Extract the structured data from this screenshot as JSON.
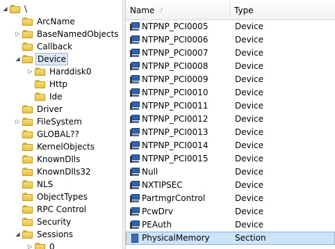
{
  "tree": {
    "items": [
      {
        "label": "\\",
        "level": 0,
        "expander": "open",
        "selected": false
      },
      {
        "label": "ArcName",
        "level": 1,
        "expander": "none",
        "selected": false
      },
      {
        "label": "BaseNamedObjects",
        "level": 1,
        "expander": "closed",
        "selected": false
      },
      {
        "label": "Callback",
        "level": 1,
        "expander": "none",
        "selected": false
      },
      {
        "label": "Device",
        "level": 1,
        "expander": "open",
        "selected": true
      },
      {
        "label": "Harddisk0",
        "level": 2,
        "expander": "closed",
        "selected": false
      },
      {
        "label": "Http",
        "level": 2,
        "expander": "none",
        "selected": false
      },
      {
        "label": "Ide",
        "level": 2,
        "expander": "none",
        "selected": false
      },
      {
        "label": "Driver",
        "level": 1,
        "expander": "none",
        "selected": false
      },
      {
        "label": "FileSystem",
        "level": 1,
        "expander": "closed",
        "selected": false
      },
      {
        "label": "GLOBAL??",
        "level": 1,
        "expander": "none",
        "selected": false
      },
      {
        "label": "KernelObjects",
        "level": 1,
        "expander": "none",
        "selected": false
      },
      {
        "label": "KnownDlls",
        "level": 1,
        "expander": "none",
        "selected": false
      },
      {
        "label": "KnownDlls32",
        "level": 1,
        "expander": "none",
        "selected": false
      },
      {
        "label": "NLS",
        "level": 1,
        "expander": "none",
        "selected": false
      },
      {
        "label": "ObjectTypes",
        "level": 1,
        "expander": "none",
        "selected": false
      },
      {
        "label": "RPC Control",
        "level": 1,
        "expander": "none",
        "selected": false
      },
      {
        "label": "Security",
        "level": 1,
        "expander": "none",
        "selected": false
      },
      {
        "label": "Sessions",
        "level": 1,
        "expander": "open",
        "selected": false
      },
      {
        "label": "0",
        "level": 2,
        "expander": "closed",
        "selected": false
      }
    ]
  },
  "list": {
    "columns": {
      "name": "Name",
      "type": "Type"
    },
    "sort_indicator": "/",
    "rows": [
      {
        "name": "NTPNP_PCI0005",
        "type": "Device",
        "icon": "device-icon",
        "selected": false
      },
      {
        "name": "NTPNP_PCI0006",
        "type": "Device",
        "icon": "device-icon",
        "selected": false
      },
      {
        "name": "NTPNP_PCI0007",
        "type": "Device",
        "icon": "device-icon",
        "selected": false
      },
      {
        "name": "NTPNP_PCI0008",
        "type": "Device",
        "icon": "device-icon",
        "selected": false
      },
      {
        "name": "NTPNP_PCI0009",
        "type": "Device",
        "icon": "device-icon",
        "selected": false
      },
      {
        "name": "NTPNP_PCI0010",
        "type": "Device",
        "icon": "device-icon",
        "selected": false
      },
      {
        "name": "NTPNP_PCI0011",
        "type": "Device",
        "icon": "device-icon",
        "selected": false
      },
      {
        "name": "NTPNP_PCI0012",
        "type": "Device",
        "icon": "device-icon",
        "selected": false
      },
      {
        "name": "NTPNP_PCI0013",
        "type": "Device",
        "icon": "device-icon",
        "selected": false
      },
      {
        "name": "NTPNP_PCI0014",
        "type": "Device",
        "icon": "device-icon",
        "selected": false
      },
      {
        "name": "NTPNP_PCI0015",
        "type": "Device",
        "icon": "device-icon",
        "selected": false
      },
      {
        "name": "Null",
        "type": "Device",
        "icon": "device-icon",
        "selected": false
      },
      {
        "name": "NXTIPSEC",
        "type": "Device",
        "icon": "device-icon",
        "selected": false
      },
      {
        "name": "PartmgrControl",
        "type": "Device",
        "icon": "device-icon",
        "selected": false
      },
      {
        "name": "PcwDrv",
        "type": "Device",
        "icon": "device-icon",
        "selected": false
      },
      {
        "name": "PEAuth",
        "type": "Device",
        "icon": "device-icon",
        "selected": false
      },
      {
        "name": "PhysicalMemory",
        "type": "Section",
        "icon": "section-icon",
        "selected": true
      }
    ]
  },
  "colors": {
    "selection": "#cde3f7",
    "selection_border": "#7eb4ea",
    "folder": "#e8c24a",
    "device_screen": "#2a63b8"
  }
}
